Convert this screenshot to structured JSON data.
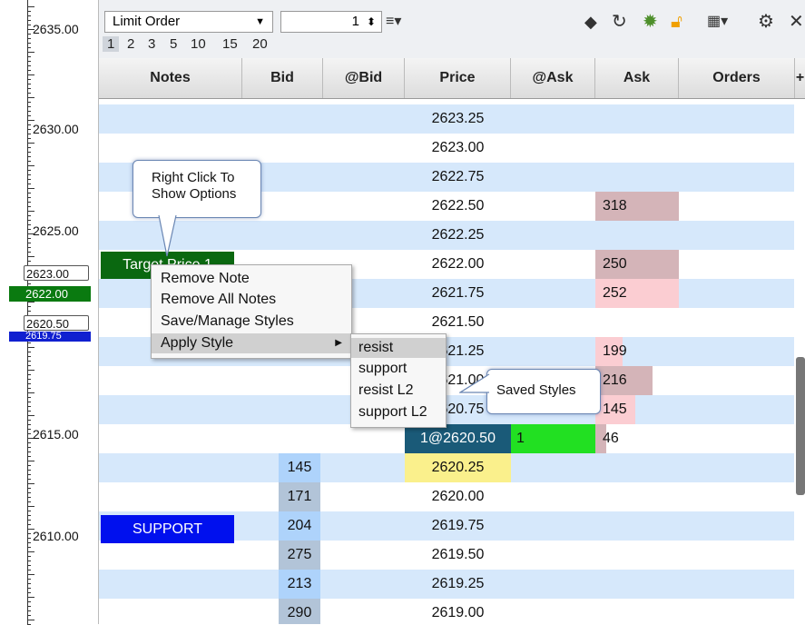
{
  "axis": {
    "labels": [
      "2635.00",
      "2630.00",
      "2625.00",
      "2620.00",
      "2615.00",
      "2610.00"
    ],
    "markers": {
      "m1": "2623.00",
      "m2": "2622.00",
      "m3": "2620.50",
      "m4": "2619.75"
    }
  },
  "toolbar": {
    "order_type": "Limit Order",
    "quantity": "1",
    "qty_presets": [
      "1",
      "2",
      "3",
      "5",
      "10",
      "15",
      "20"
    ],
    "icons": [
      "eraser-icon",
      "refresh-icon",
      "center-icon",
      "lock-icon",
      "layout-icon",
      "gear-icon",
      "close-icon"
    ]
  },
  "columns": [
    "Notes",
    "Bid",
    "@Bid",
    "Price",
    "@Ask",
    "Ask",
    "Orders",
    "+"
  ],
  "rows": [
    {
      "price": "2623.25",
      "bid": "",
      "ask": ""
    },
    {
      "price": "2623.00",
      "bid": "",
      "ask": ""
    },
    {
      "price": "2622.75",
      "bid": "",
      "ask": ""
    },
    {
      "price": "2622.50",
      "bid": "",
      "ask": "318"
    },
    {
      "price": "2622.25",
      "bid": "",
      "ask": ""
    },
    {
      "price": "2622.00",
      "bid": "",
      "ask": "250"
    },
    {
      "price": "2621.75",
      "bid": "",
      "ask": "252"
    },
    {
      "price": "2621.50",
      "bid": "",
      "ask": ""
    },
    {
      "price": "2621.25",
      "bid": "",
      "ask": "199"
    },
    {
      "price": "2621.00",
      "bid": "",
      "ask": "216"
    },
    {
      "price": "2620.75",
      "bid": "",
      "ask": "145"
    },
    {
      "price": "1@2620.50",
      "bid": "",
      "ask": "46",
      "ask_depth": "1"
    },
    {
      "price": "2620.25",
      "bid": "145",
      "ask": ""
    },
    {
      "price": "2620.00",
      "bid": "171",
      "ask": ""
    },
    {
      "price": "2619.75",
      "bid": "204",
      "ask": ""
    },
    {
      "price": "2619.50",
      "bid": "275",
      "ask": ""
    },
    {
      "price": "2619.25",
      "bid": "213",
      "ask": ""
    },
    {
      "price": "2619.00",
      "bid": "290",
      "ask": ""
    }
  ],
  "notes": {
    "target": "Target Price 1",
    "support": "SUPPORT"
  },
  "tooltips": {
    "right_click": "Right Click To Show Options",
    "saved_styles": "Saved Styles"
  },
  "context_menu": {
    "items": [
      "Remove Note",
      "Remove All Notes",
      "Save/Manage Styles",
      "Apply Style"
    ],
    "submenu": [
      "resist",
      "support",
      "resist L2",
      "support L2"
    ]
  },
  "colors": {
    "row_stripe": "#d6e8fb",
    "ask_high": "#d4b4b8",
    "ask_low": "#fbcdd2",
    "bid_dark": "#b2c4d8",
    "bid_light": "#aed3fb",
    "current": "#1a5a78",
    "highlight_yellow": "#faf08c",
    "green": "#22e022",
    "target_green": "#0a6810",
    "support_blue": "#0010ee"
  }
}
